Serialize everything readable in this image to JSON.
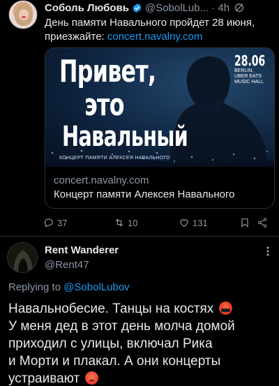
{
  "tweet": {
    "author_name": "Соболь Любовь",
    "author_handle": "@SobolLub... · 4h",
    "text_line1": "День памяти Навального пройдет 28 июня,",
    "text_line2_prefix": "приезжайте: ",
    "text_link": "concert.navalny.com",
    "card": {
      "poster_title_1": "Привет,",
      "poster_title_2": "это",
      "poster_title_3": "Навальный",
      "poster_subtitle": "КОНЦЕРТ ПАМЯТИ АЛЕКСЕЯ НАВАЛЬНОГО",
      "poster_date": "28.06",
      "poster_venue_1": "BERLIN,",
      "poster_venue_2": "UBER EATS",
      "poster_venue_3": "MUSIC HALL",
      "domain": "concert.navalny.com",
      "title": "Концерт памяти Алексея Навального"
    },
    "actions": {
      "replies": "37",
      "retweets": "10",
      "likes": "131"
    }
  },
  "reply": {
    "author_name": "Rent Wanderer",
    "author_handle": "@Rent47",
    "replying_prefix": "Replying to ",
    "replying_to": "@SobolLubov",
    "line1": "Навальнобесие. Танцы на костях",
    "line2": "У меня дед в этот день молча домой",
    "line3": "приходил с улицы,  включал Рика",
    "line4": "и Морти и плакал. А они концерты",
    "line5": "устраивают"
  },
  "colors": {
    "background": "#000000",
    "text": "#e7e9ea",
    "secondary": "#8b98a5",
    "link": "#1d9bf0",
    "verified": "#1d9bf0"
  }
}
